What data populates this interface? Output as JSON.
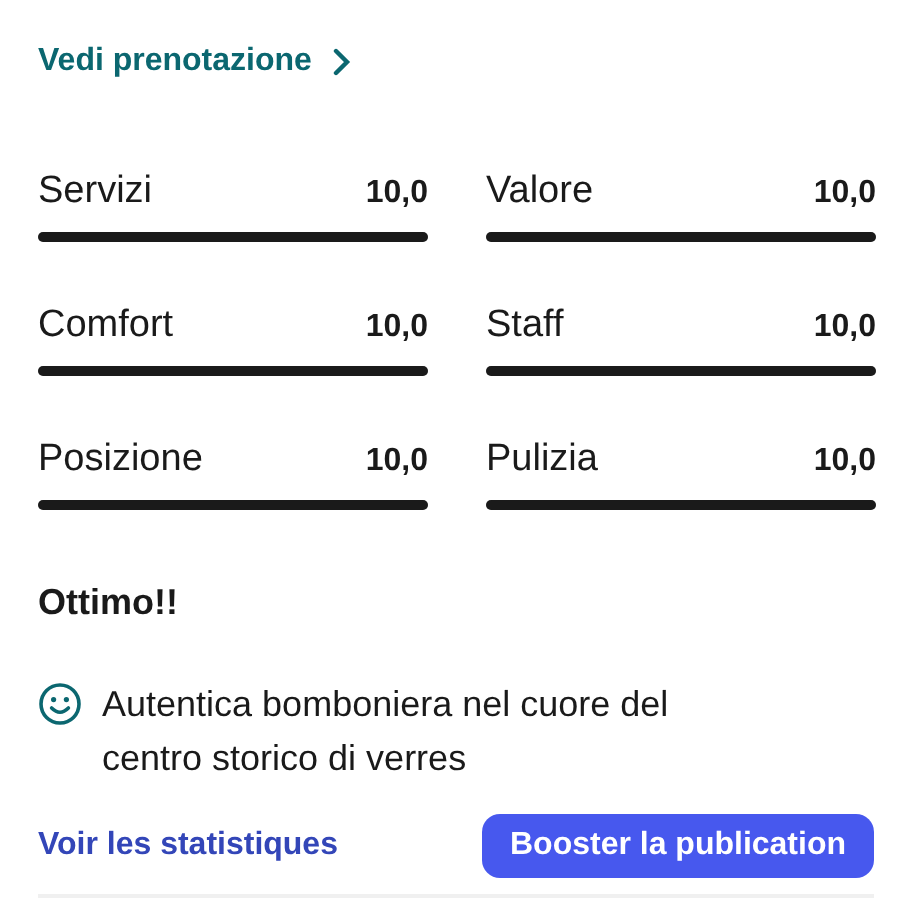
{
  "booking_link": {
    "label": "Vedi prenotazione"
  },
  "scores": [
    {
      "name": "Servizi",
      "value": "10,0",
      "level": 1
    },
    {
      "name": "Valore",
      "value": "10,0",
      "level": 1
    },
    {
      "name": "Comfort",
      "value": "10,0",
      "level": 1
    },
    {
      "name": "Staff",
      "value": "10,0",
      "level": 1
    },
    {
      "name": "Posizione",
      "value": "10,0",
      "level": 1
    },
    {
      "name": "Pulizia",
      "value": "10,0",
      "level": 1
    }
  ],
  "review": {
    "title": "Ottimo!!",
    "positive": "Autentica bomboniera nel cuore del centro storico di verres"
  },
  "actions": {
    "stats_link": "Voir les statistiques",
    "boost_button": "Booster la publication"
  }
}
